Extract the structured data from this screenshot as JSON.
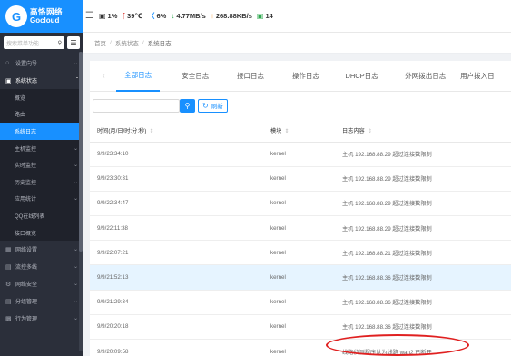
{
  "logo": {
    "mark": "G",
    "name_cn": "高恪网络",
    "name_en": "Gocloud"
  },
  "menu_search": {
    "placeholder": "搜索菜单功能"
  },
  "sidebar": {
    "items": [
      {
        "label": "设置向导",
        "icon": "circle-icon"
      },
      {
        "label": "系统状态",
        "icon": "monitor-icon"
      },
      {
        "label": "网络设置",
        "icon": "network-icon"
      },
      {
        "label": "流控多线",
        "icon": "flow-icon"
      },
      {
        "label": "网络安全",
        "icon": "security-icon"
      },
      {
        "label": "分组管理",
        "icon": "group-icon"
      },
      {
        "label": "行为管理",
        "icon": "behavior-icon"
      }
    ],
    "subitems": [
      {
        "label": "概览"
      },
      {
        "label": "路由"
      },
      {
        "label": "系统日志"
      },
      {
        "label": "主机监控"
      },
      {
        "label": "实时监控"
      },
      {
        "label": "历史监控"
      },
      {
        "label": "应用统计"
      },
      {
        "label": "QQ在线列表"
      },
      {
        "label": "接口概览"
      }
    ]
  },
  "topbar": {
    "cpu": "1%",
    "temp": "39℃",
    "mem": "6%",
    "down": "4.77MB/s",
    "up": "268.88KB/s",
    "online": "14"
  },
  "breadcrumb": {
    "home": "首页",
    "parent": "系统状态",
    "current": "系统日志"
  },
  "tabs": [
    "全部日志",
    "安全日志",
    "接口日志",
    "操作日志",
    "DHCP日志",
    "外网拨出日志",
    "用户拨入日"
  ],
  "toolbar": {
    "refresh_label": "刷新"
  },
  "table": {
    "headers": [
      "时间(月/日/时:分:秒)",
      "模块",
      "日志内容"
    ],
    "rows": [
      [
        "9/9/23:34:10",
        "kernel",
        "主机 192.168.88.29 超过连接数限制"
      ],
      [
        "9/9/23:30:31",
        "kernel",
        "主机 192.168.88.29 超过连接数限制"
      ],
      [
        "9/9/22:34:47",
        "kernel",
        "主机 192.168.88.29 超过连接数限制"
      ],
      [
        "9/9/22:11:38",
        "kernel",
        "主机 192.168.88.29 超过连接数限制"
      ],
      [
        "9/9/22:07:21",
        "kernel",
        "主机 192.168.88.21 超过连接数限制"
      ],
      [
        "9/9/21:52:13",
        "kernel",
        "主机 192.168.88.36 超过连接数限制"
      ],
      [
        "9/9/21:29:34",
        "kernel",
        "主机 192.168.88.36 超过连接数限制"
      ],
      [
        "9/9/20:20:18",
        "kernel",
        "主机 192.168.88.36 超过连接数限制"
      ],
      [
        "9/9/20:09:58",
        "kernel",
        "线路侦测程序认为线路 wan2 已断开"
      ]
    ]
  },
  "colors": {
    "accent": "#1890ff",
    "sidebar_bg": "#2b2f3a",
    "annotation": "#e02020"
  }
}
